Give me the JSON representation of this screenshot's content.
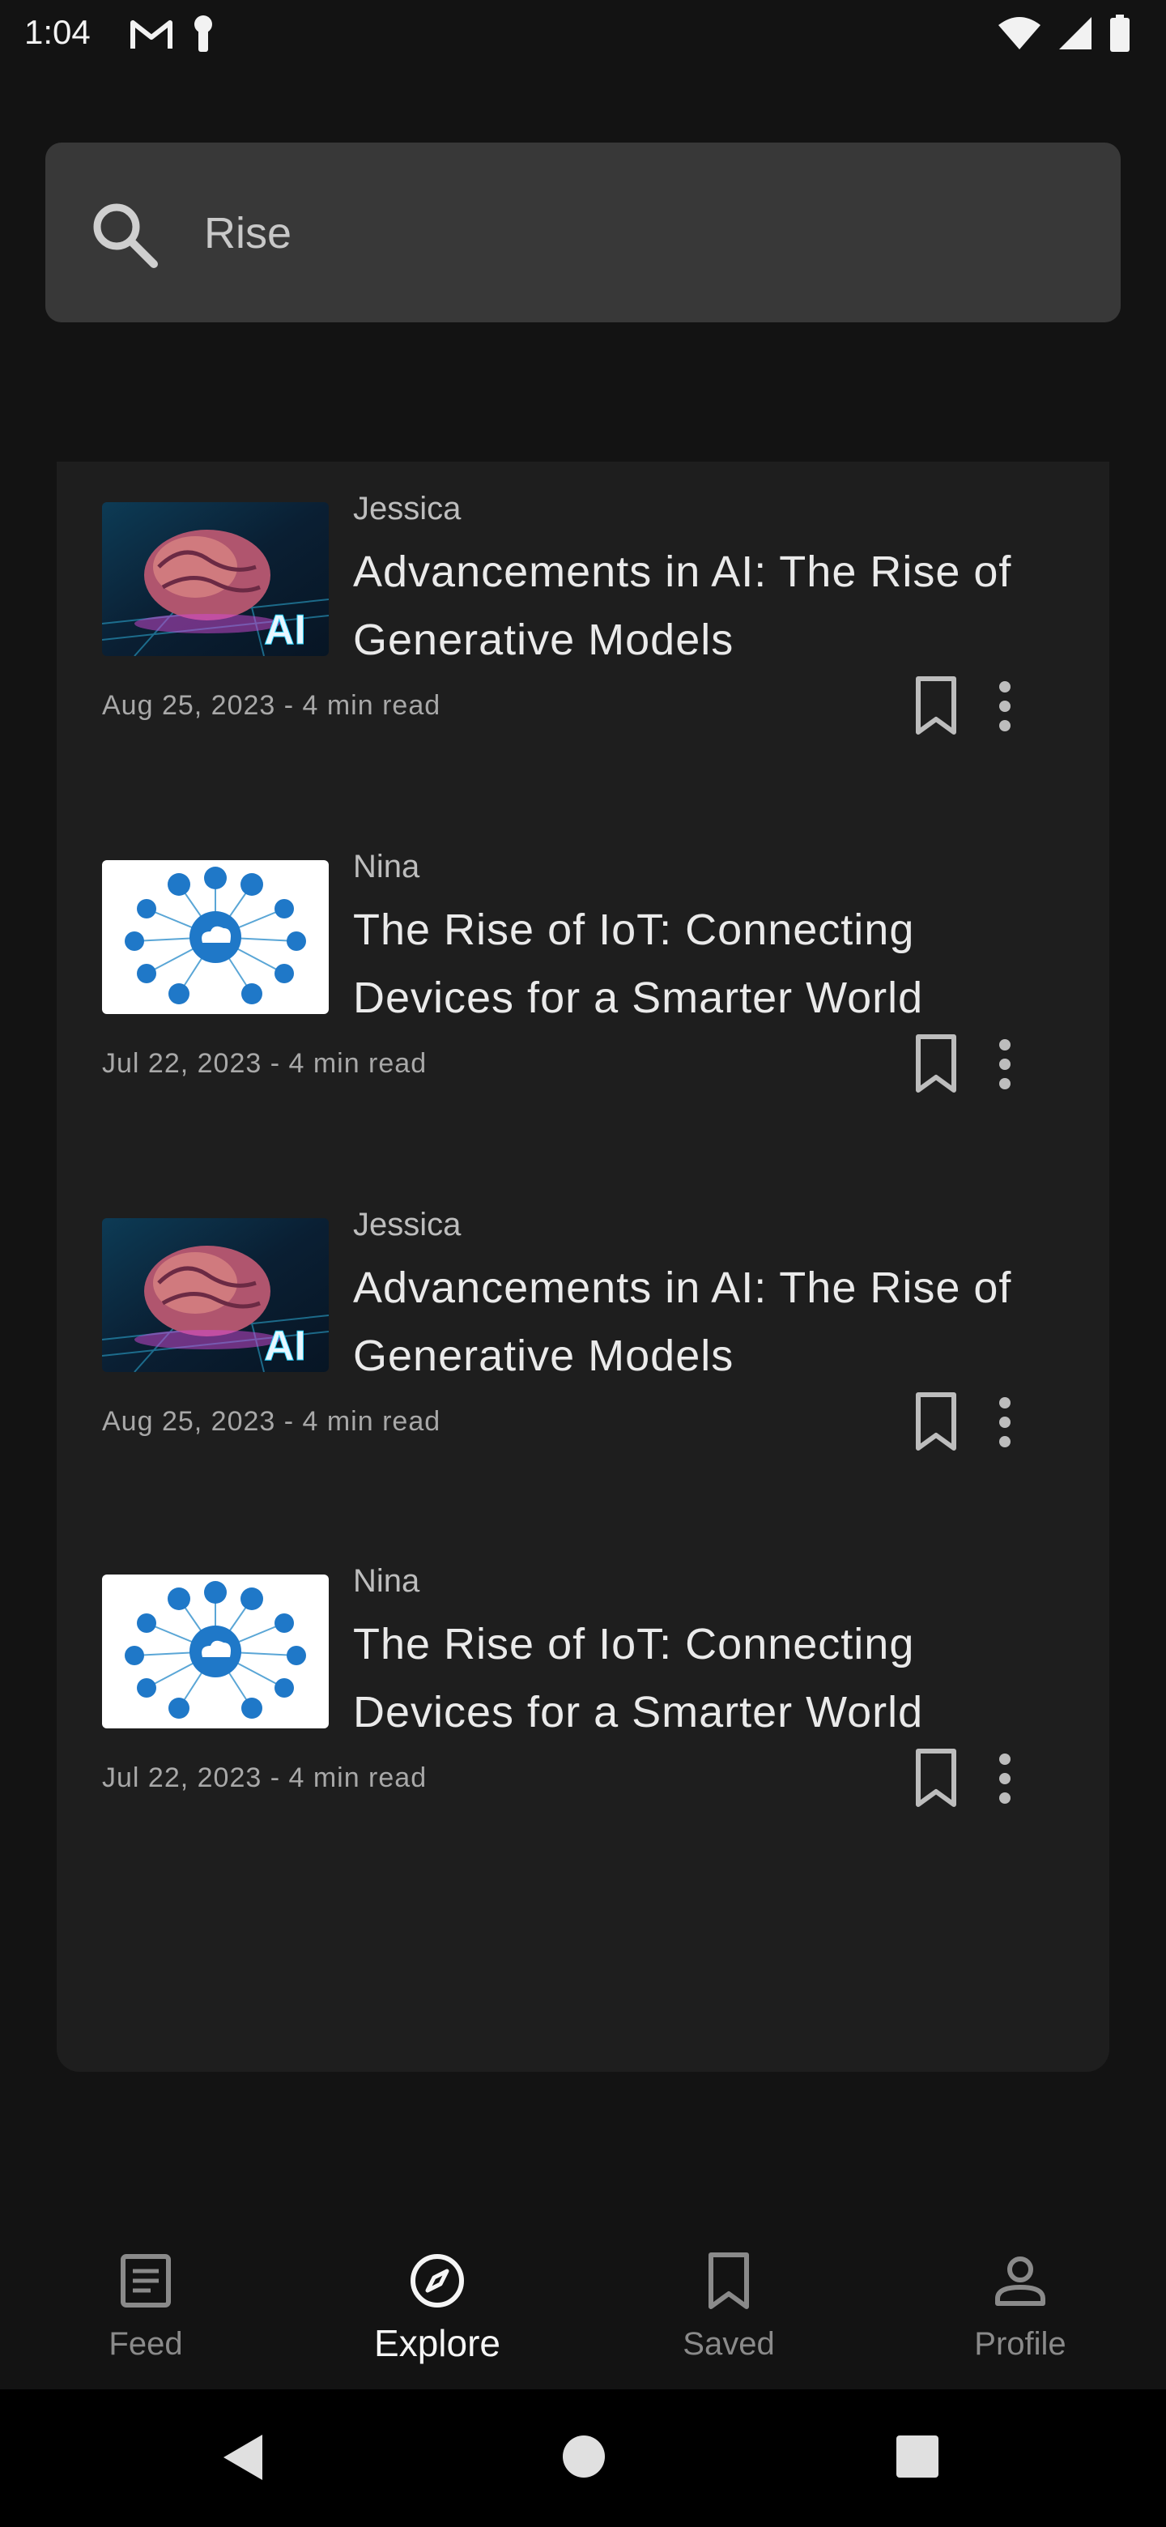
{
  "status_bar": {
    "time": "1:04",
    "left_icons": [
      "gmail-icon",
      "key-icon"
    ],
    "right_icons": [
      "wifi-icon",
      "signal-icon",
      "battery-icon"
    ]
  },
  "search": {
    "value": "Rise",
    "icon": "search-icon"
  },
  "articles": [
    {
      "author": "Jessica",
      "title": "Advancements in AI: The Rise of Generative Models",
      "meta": "Aug 25, 2023 - 4 min read",
      "thumbnail": "ai-brain-image"
    },
    {
      "author": "Nina",
      "title": "The Rise of IoT: Connecting Devices for a Smarter World",
      "meta": "Jul 22, 2023 - 4 min read",
      "thumbnail": "iot-network-image"
    },
    {
      "author": "Jessica",
      "title": "Advancements in AI: The Rise of Generative Models",
      "meta": "Aug 25, 2023 - 4 min read",
      "thumbnail": "ai-brain-image"
    },
    {
      "author": "Nina",
      "title": "The Rise of IoT: Connecting Devices for a Smarter World",
      "meta": "Jul 22, 2023 - 4 min read",
      "thumbnail": "iot-network-image"
    }
  ],
  "bottom_nav": {
    "active": "Explore",
    "items": [
      {
        "label": "Feed",
        "icon": "feed-icon"
      },
      {
        "label": "Explore",
        "icon": "compass-icon"
      },
      {
        "label": "Saved",
        "icon": "bookmark-icon"
      },
      {
        "label": "Profile",
        "icon": "person-icon"
      }
    ]
  },
  "colors": {
    "background": "#131313",
    "panel": "#1e1e1e",
    "search_bg": "#383838",
    "active_nav": "#f5f5f5",
    "inactive_nav": "#8a8a8a"
  }
}
